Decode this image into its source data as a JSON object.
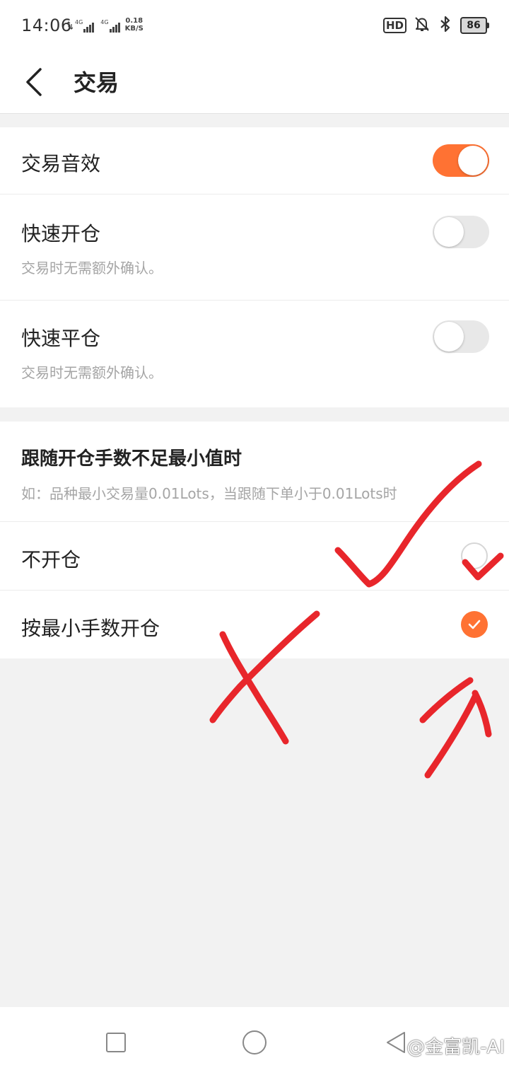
{
  "status_bar": {
    "time": "14:06",
    "sim1_label": "4G",
    "sim2_label": "4G",
    "net_speed_value": "0.18",
    "net_speed_unit": "KB/S",
    "hd_label": "HD",
    "battery": "86",
    "icons": [
      "data-arrows-icon",
      "signal-icon",
      "bell-off-icon",
      "bluetooth-icon",
      "battery-icon"
    ]
  },
  "header": {
    "back_icon": "chevron-left-icon",
    "title": "交易"
  },
  "settings": {
    "sound": {
      "label": "交易音效",
      "enabled": true
    },
    "quick_open": {
      "label": "快速开仓",
      "desc": "交易时无需额外确认。",
      "enabled": false
    },
    "quick_close": {
      "label": "快速平仓",
      "desc": "交易时无需额外确认。",
      "enabled": false
    }
  },
  "follow": {
    "title": "跟随开仓手数不足最小值时",
    "desc": "如：品种最小交易量0.01Lots，当跟随下单小于0.01Lots时",
    "options": [
      {
        "label": "不开仓",
        "selected": false
      },
      {
        "label": "按最小手数开仓",
        "selected": true
      }
    ]
  },
  "nav": {
    "icons": [
      "recent-apps-icon",
      "home-icon",
      "back-icon"
    ]
  },
  "watermark": "@金富凯-AI",
  "colors": {
    "accent": "#ff7233",
    "annotation_red": "#e8262b",
    "background": "#f2f2f2"
  }
}
